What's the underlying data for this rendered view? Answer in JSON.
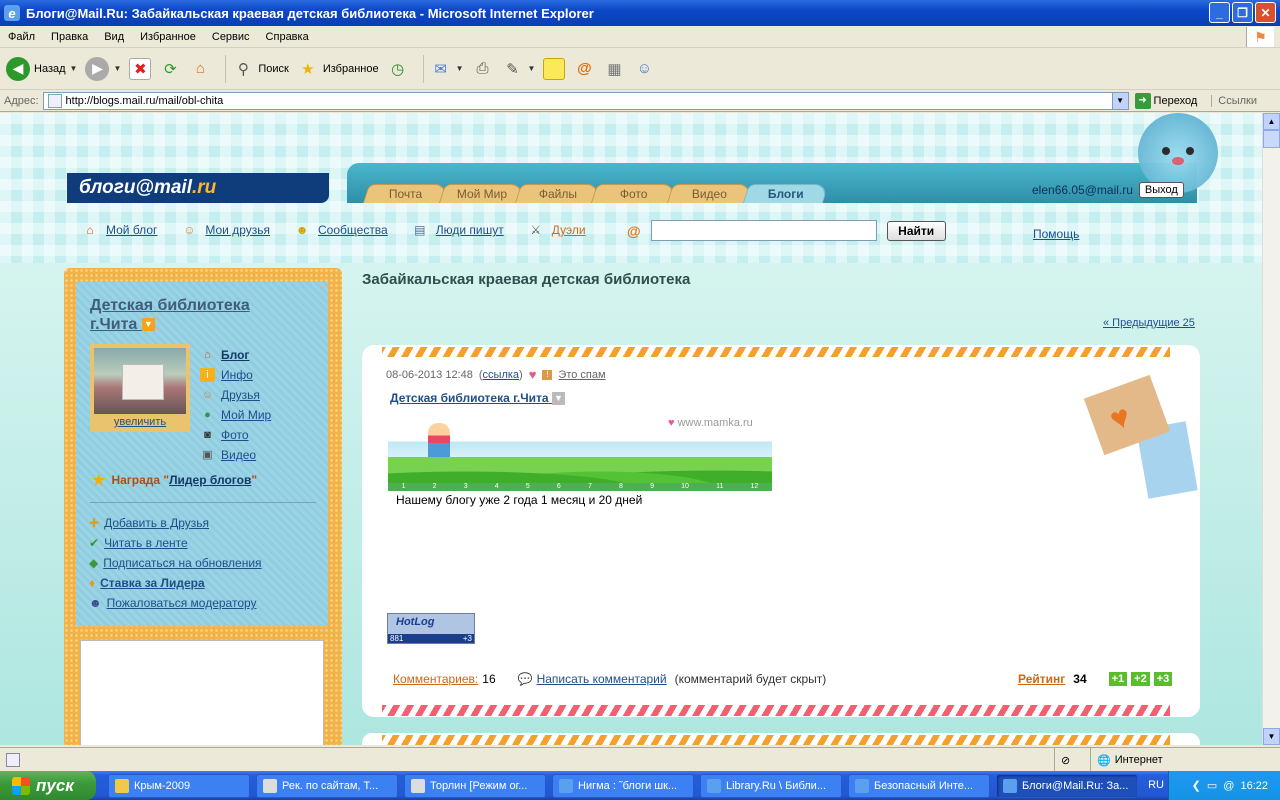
{
  "window": {
    "title": "Блоги@Mail.Ru: Забайкальская краевая детская библиотека - Microsoft Internet Explorer"
  },
  "menu": [
    "Файл",
    "Правка",
    "Вид",
    "Избранное",
    "Сервис",
    "Справка"
  ],
  "toolbar": {
    "back": "Назад",
    "search": "Поиск",
    "favorites": "Избранное"
  },
  "address": {
    "label": "Адрес:",
    "url": "http://blogs.mail.ru/mail/obl-chita",
    "go": "Переход",
    "links": "Ссылки"
  },
  "site": {
    "logo_main": "блоги@mail",
    "logo_ru": ".ru",
    "tabs": [
      "Почта",
      "Мой Мир",
      "Файлы",
      "Фото",
      "Видео",
      "Блоги"
    ],
    "user_email": "elen66.05@mail.ru",
    "exit": "Выход",
    "subnav": [
      "Мой блог",
      "Мои друзья",
      "Сообщества",
      "Люди пишут",
      "Дуэли"
    ],
    "search_button": "Найти",
    "help": "Помощь"
  },
  "sidebar": {
    "blog_name": "Детская библиотека г.Чита",
    "photo_caption": "увеличить",
    "links": [
      "Блог",
      "Инфо",
      "Друзья",
      "Мой Мир",
      "Фото",
      "Видео"
    ],
    "award_label": "Награда \"",
    "award_name": "Лидер блогов",
    "award_end": "\"",
    "actions": [
      "Добавить в Друзья",
      "Читать в ленте",
      "Подписаться на обновления",
      "Ставка за Лидера",
      "Пожаловаться модератору"
    ]
  },
  "main": {
    "title": "Забайкальская краевая детская библиотека",
    "prev": "«  Предыдущие 25",
    "post": {
      "date": "08-06-2013 12:48",
      "link": "ссылка",
      "spam": "Это спам",
      "author": "Детская библиотека г.Чита",
      "banner_site": "www.mamka.ru",
      "banner_ticks": [
        "1",
        "2",
        "3",
        "4",
        "5",
        "6",
        "7",
        "8",
        "9",
        "10",
        "11",
        "12"
      ],
      "message": "Нашему блогу уже 2 года 1 месяц и 20 дней",
      "hotlog": "HotLog",
      "hotlog_count": "881",
      "hotlog_plus": "+3",
      "comments_label": "Комментариев:",
      "comments_count": "16",
      "write_comment": "Написать комментарий",
      "comment_note": "(комментарий будет скрыт)",
      "rating_label": "Рейтинг",
      "rating_value": "34",
      "votes": [
        "+1",
        "+2",
        "+3"
      ]
    }
  },
  "status": {
    "zone": "Интернет"
  },
  "taskbar": {
    "start": "пуск",
    "tasks": [
      "Крым-2009",
      "Рек. по сайтам, Т...",
      "Торлин [Режим ог...",
      "Нигма : ˜блоги шк...",
      "Library.Ru \\ Библи...",
      "Безопасный Инте...",
      "Блоги@Mail.Ru: За..."
    ],
    "lang": "RU",
    "time": "16:22"
  }
}
